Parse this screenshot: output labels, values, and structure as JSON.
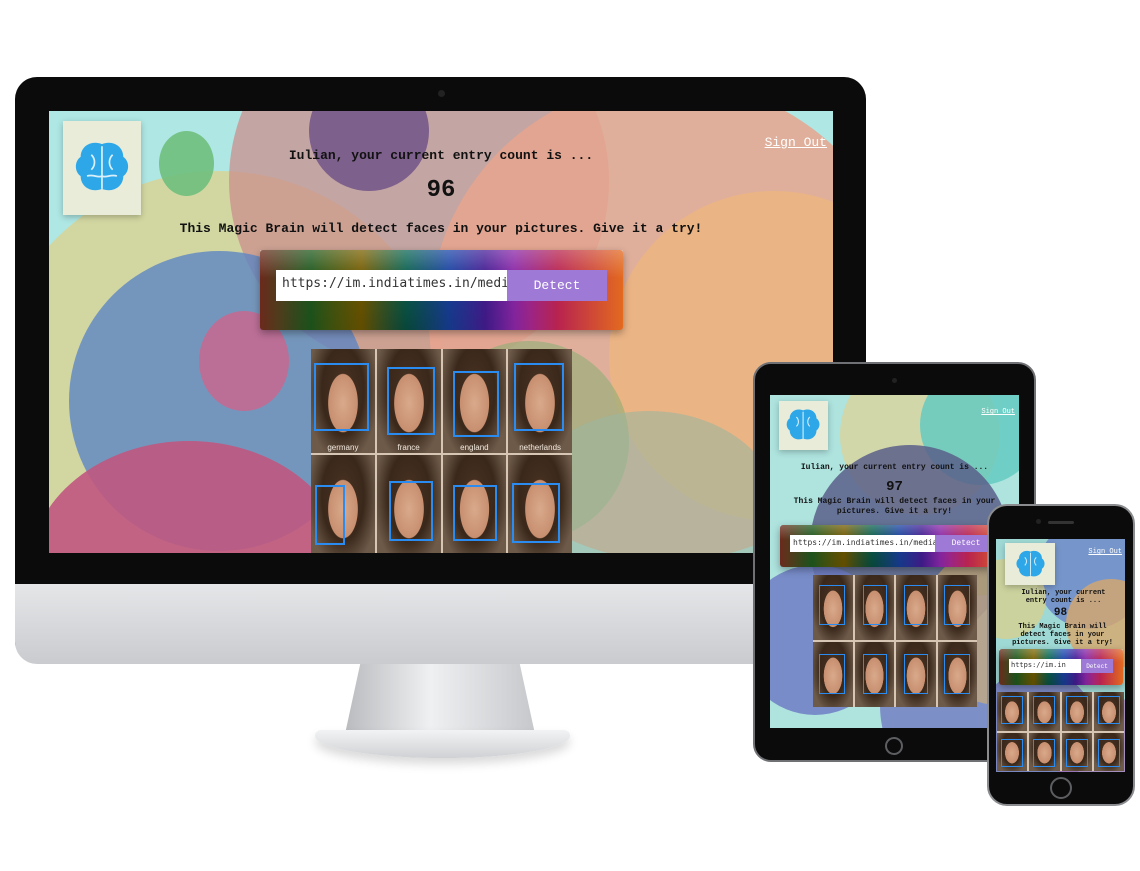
{
  "app": {
    "greeting": "Iulian, your current entry count is ...",
    "tagline": "This Magic Brain will detect faces in your pictures. Give it a try!",
    "sign_out_label": "Sign Out",
    "detect_label": "Detect",
    "logo_icon": "brain-icon"
  },
  "desktop": {
    "entry_count": "96",
    "url_value": "https://im.indiatimes.in/media/",
    "face_captions": [
      "germany",
      "france",
      "england",
      "netherlands"
    ]
  },
  "tablet": {
    "entry_count": "97",
    "url_value": "https://im.indiatimes.in/media/"
  },
  "phone": {
    "entry_count": "98",
    "url_value": "https://im.in"
  },
  "colors": {
    "accent_button": "#9e7ad6",
    "face_box": "#2a8cf0",
    "screen_base": "#aee7e4"
  }
}
